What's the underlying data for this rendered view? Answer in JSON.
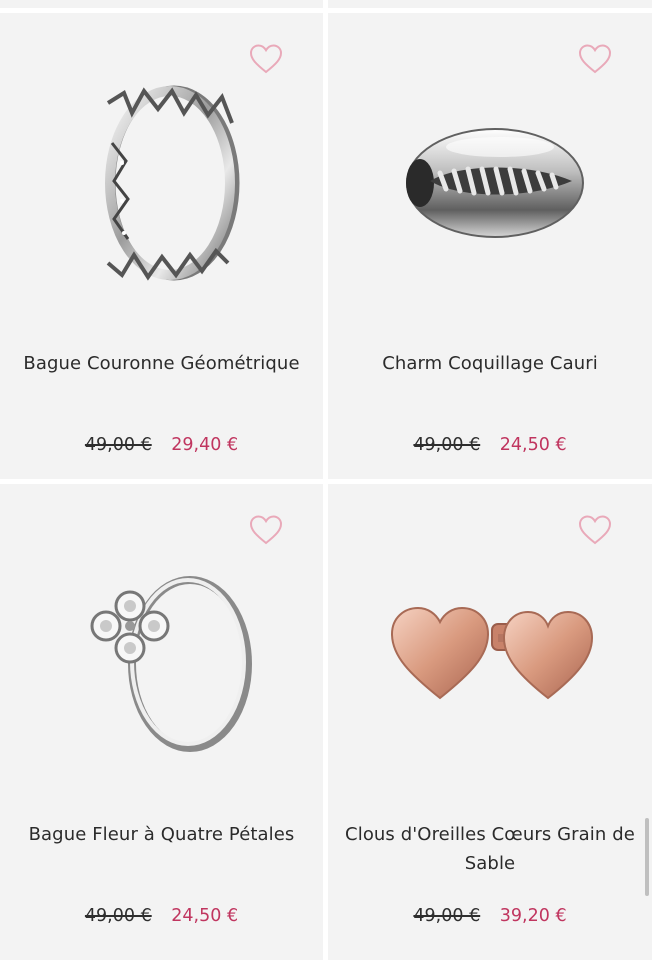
{
  "products": [
    {
      "name": "Bague Couronne Géométrique",
      "old_price": "49,00 €",
      "sale_price": "29,40 €",
      "image_icon": "crown-ring-icon"
    },
    {
      "name": "Charm Coquillage Cauri",
      "old_price": "49,00 €",
      "sale_price": "24,50 €",
      "image_icon": "cowrie-shell-charm-icon"
    },
    {
      "name": "Bague Fleur à Quatre Pétales",
      "old_price": "49,00 €",
      "sale_price": "24,50 €",
      "image_icon": "flower-ring-icon"
    },
    {
      "name": "Clous d'Oreilles Cœurs Grain de Sable",
      "old_price": "49,00 €",
      "sale_price": "39,20 €",
      "image_icon": "heart-earrings-icon"
    }
  ],
  "colors": {
    "sale_price": "#c0355f",
    "heart_outline": "#e9a9b9",
    "card_background": "#f3f3f3"
  }
}
